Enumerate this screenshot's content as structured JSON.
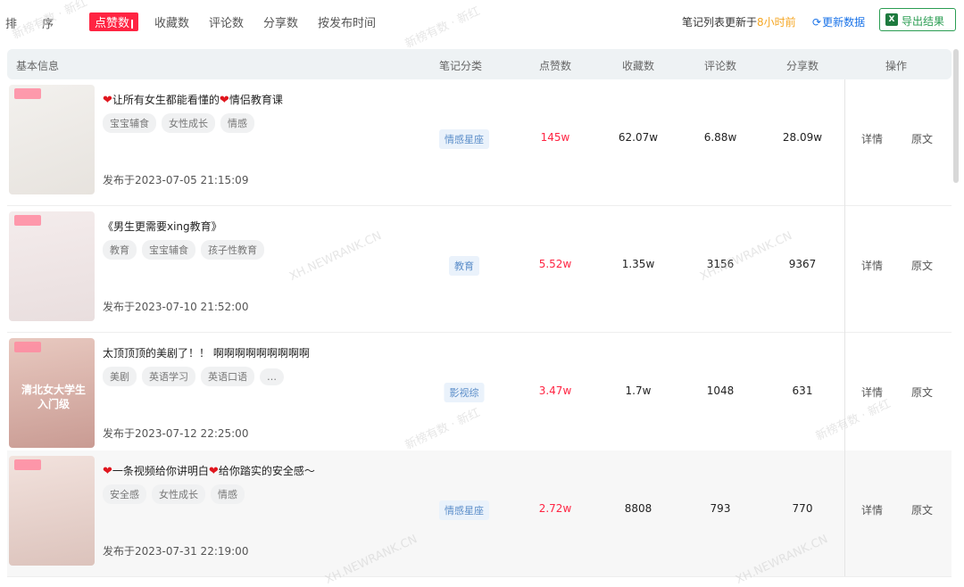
{
  "sort": {
    "label": "排 序",
    "options": [
      {
        "label": "点赞数",
        "active": true
      },
      {
        "label": "收藏数",
        "active": false
      },
      {
        "label": "评论数",
        "active": false
      },
      {
        "label": "分享数",
        "active": false
      },
      {
        "label": "按发布时间",
        "active": false
      }
    ]
  },
  "update": {
    "prefix": "笔记列表更新于",
    "highlight": "8小时前",
    "refresh_label": "更新数据",
    "export_label": "导出结果",
    "export_icon": "excel-icon"
  },
  "table": {
    "headers": [
      "基本信息",
      "笔记分类",
      "点赞数",
      "收藏数",
      "评论数",
      "分享数",
      "操作"
    ],
    "actions": {
      "detail": "详情",
      "origin": "原文"
    },
    "rows": [
      {
        "title_prefix": "❤",
        "title": "让所有女生都能看懂的",
        "title_mid": "❤",
        "title_suffix": "情侣教育课",
        "tags": [
          "宝宝辅食",
          "女性成长",
          "情感"
        ],
        "date": "发布于2023-07-05 21:15:09",
        "category": "情感星座",
        "likes": "145w",
        "collects": "62.07w",
        "comments": "6.88w",
        "shares": "28.09w",
        "thumb_text": ""
      },
      {
        "title_prefix": "",
        "title": "《男生更需要xing教育》",
        "title_mid": "",
        "title_suffix": "",
        "tags": [
          "教育",
          "宝宝辅食",
          "孩子性教育"
        ],
        "date": "发布于2023-07-10 21:52:00",
        "category": "教育",
        "likes": "5.52w",
        "collects": "1.35w",
        "comments": "3156",
        "shares": "9367",
        "thumb_text": ""
      },
      {
        "title_prefix": "",
        "title": "太顶顶顶的美剧了！！ 啊啊啊啊啊啊啊啊啊",
        "title_mid": "",
        "title_suffix": "",
        "tags": [
          "美剧",
          "英语学习",
          "英语口语",
          "…"
        ],
        "date": "发布于2023-07-12 22:25:00",
        "category": "影视综",
        "likes": "3.47w",
        "collects": "1.7w",
        "comments": "1048",
        "shares": "631",
        "thumb_text": "清北女大学生 入门级"
      },
      {
        "title_prefix": "❤",
        "title": "一条视频给你讲明白",
        "title_mid": "❤",
        "title_suffix": "给你踏实的安全感～",
        "tags": [
          "安全感",
          "女性成长",
          "情感"
        ],
        "date": "发布于2023-07-31 22:19:00",
        "category": "情感星座",
        "likes": "2.72w",
        "collects": "8808",
        "comments": "793",
        "shares": "770",
        "thumb_text": ""
      }
    ]
  },
  "watermark": {
    "text_cn": "新榜有数 · 新红",
    "text_en": "XH.NEWRANK.CN"
  },
  "colors": {
    "accent": "#ff2442",
    "export": "#2a9d52",
    "link": "#1a73e8",
    "highlight": "#f5a623"
  }
}
